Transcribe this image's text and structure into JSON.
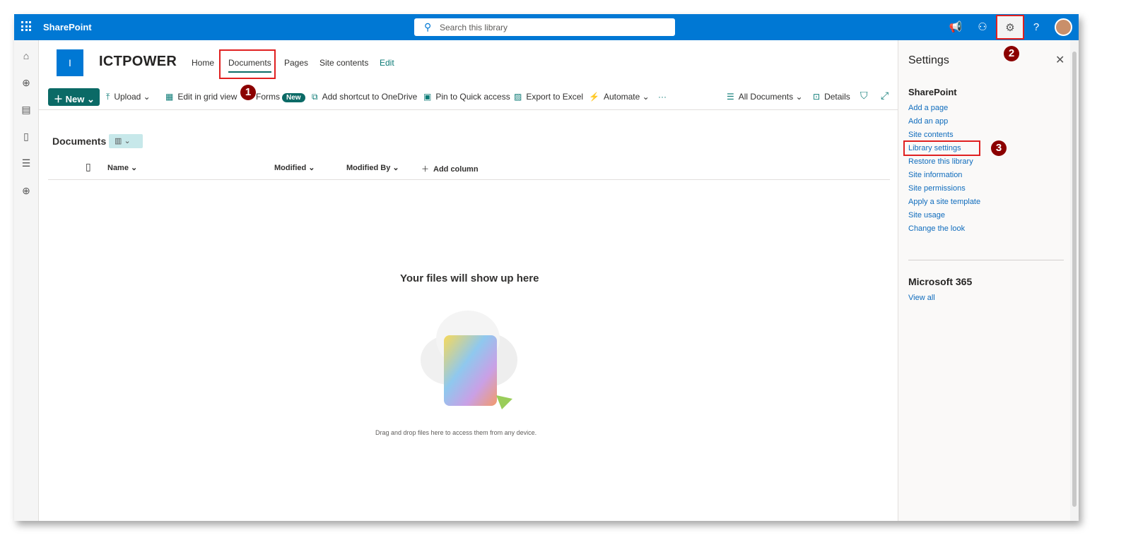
{
  "topbar": {
    "app_name": "SharePoint",
    "search_placeholder": "Search this library",
    "help": "?"
  },
  "site": {
    "logo_letter": "I",
    "name": "ICTPOWER",
    "nav": [
      {
        "label": "Home"
      },
      {
        "label": "Documents"
      },
      {
        "label": "Pages"
      },
      {
        "label": "Site contents"
      },
      {
        "label": "Edit"
      }
    ]
  },
  "commands": {
    "new": "New",
    "upload": "Upload",
    "grid": "Edit in grid view",
    "forms": "Forms",
    "forms_badge": "New",
    "shortcut": "Add shortcut to OneDrive",
    "pin": "Pin to Quick access",
    "export": "Export to Excel",
    "automate": "Automate",
    "more": "···",
    "view": "All Documents",
    "details": "Details"
  },
  "library": {
    "title": "Documents",
    "columns": [
      "Name",
      "Modified",
      "Modified By",
      "Add column"
    ],
    "empty_title": "Your files will show up here",
    "empty_hint": "Drag and drop files here to access them from any device."
  },
  "settings": {
    "title": "Settings",
    "section1": "SharePoint",
    "links": [
      "Add a page",
      "Add an app",
      "Site contents",
      "Library settings",
      "Restore this library",
      "Site information",
      "Site permissions",
      "Apply a site template",
      "Site usage",
      "Change the look"
    ],
    "section2": "Microsoft 365",
    "view_all": "View all"
  },
  "annotations": [
    "1",
    "2",
    "3"
  ],
  "colors": {
    "brand": "#0078d4",
    "accent": "#0b6a66",
    "highlight": "#e02020",
    "badge": "#8b0000"
  }
}
